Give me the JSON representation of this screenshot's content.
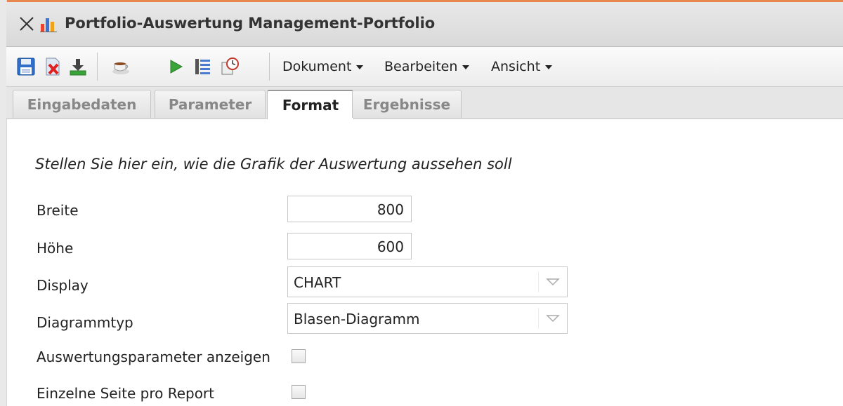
{
  "window": {
    "title": "Portfolio-Auswertung Management-Portfolio"
  },
  "toolbar": {
    "icons": [
      "save-icon",
      "delete-document-icon",
      "download-icon",
      "coffee-icon",
      "run-icon",
      "list-icon",
      "schedule-icon"
    ],
    "menus": {
      "dokument": "Dokument",
      "bearbeiten": "Bearbeiten",
      "ansicht": "Ansicht"
    }
  },
  "tabs": {
    "eingabedaten": "Eingabedaten",
    "parameter": "Parameter",
    "format": "Format",
    "ergebnisse": "Ergebnisse",
    "active": "Format"
  },
  "form": {
    "intro": "Stellen Sie hier ein, wie die Grafik der Auswertung aussehen soll",
    "breite": {
      "label": "Breite",
      "value": "800"
    },
    "hoehe": {
      "label": "Höhe",
      "value": "600"
    },
    "display": {
      "label": "Display",
      "value": "CHART"
    },
    "diagrammtyp": {
      "label": "Diagrammtyp",
      "value": "Blasen-Diagramm"
    },
    "auswertungsparameter": {
      "label": "Auswertungsparameter anzeigen",
      "checked": false
    },
    "einzelne_seite": {
      "label": "Einzelne Seite pro Report",
      "checked": false
    }
  },
  "colors": {
    "accent": "#e9864f",
    "save_blue": "#2f6fc9",
    "run_green": "#3aa33a"
  }
}
